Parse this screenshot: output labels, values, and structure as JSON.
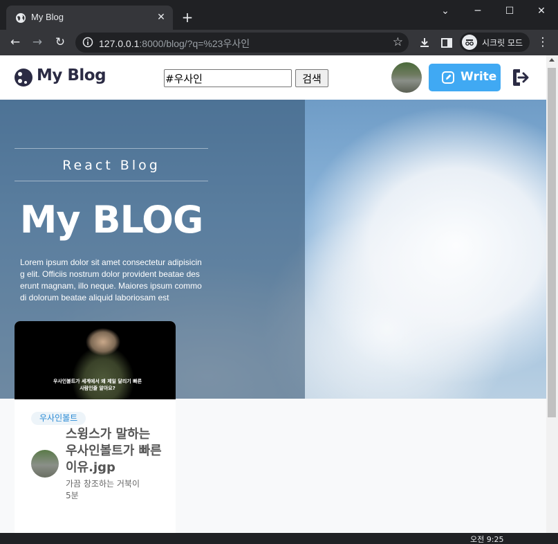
{
  "browser": {
    "tab_title": "My Blog",
    "tab_close": "✕",
    "new_tab": "+",
    "window_controls": {
      "minimize": "─",
      "maximize": "☐",
      "close": "✕"
    },
    "chevron": "⌄",
    "url_host": "127.0.0.1",
    "url_rest": ":8000/blog/?q=%23우사인",
    "incognito_label": "시크릿 모드",
    "nav": {
      "back": "←",
      "forward": "→",
      "reload": "↻",
      "star": "☆",
      "menu": "⋮"
    }
  },
  "header": {
    "logo_text": "My Blog",
    "search_value": "#우사인",
    "search_button": "검색",
    "write_label": "Write"
  },
  "hero": {
    "subtitle": "React Blog",
    "title": "My BLOG",
    "text": "Lorem ipsum dolor sit amet consectetur adipisicing elit. Officiis nostrum dolor provident beatae deserunt magnam, illo neque. Maiores ipsum commodi dolorum beatae aliquid laboriosam est"
  },
  "card": {
    "thumb_caption": "우사인볼트가 세계에서 왜 제일 달리기 빠른 사람인줄 알아요?",
    "tag": "우사인볼트",
    "title": "스윙스가 말하는 우사인볼트가 빠른 이유.jgp",
    "author": "가끔 창조하는 거북이",
    "time": "5분"
  },
  "taskbar": {
    "time": "오전 9:25"
  },
  "colors": {
    "accent": "#40a9f3",
    "tag_text": "#2b8bd5",
    "tag_bg": "#edf4f9"
  }
}
